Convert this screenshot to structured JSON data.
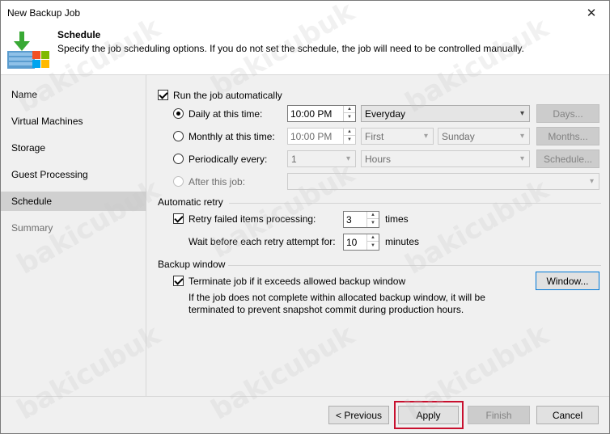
{
  "window": {
    "title": "New Backup Job",
    "close_glyph": "✕"
  },
  "header": {
    "title": "Schedule",
    "description": "Specify the job scheduling options. If you do not set the schedule, the job will need to be controlled manually.",
    "icon": "backup-job-icon"
  },
  "sidebar": {
    "items": [
      {
        "label": "Name",
        "state": "normal"
      },
      {
        "label": "Virtual Machines",
        "state": "normal"
      },
      {
        "label": "Storage",
        "state": "normal"
      },
      {
        "label": "Guest Processing",
        "state": "normal"
      },
      {
        "label": "Schedule",
        "state": "active"
      },
      {
        "label": "Summary",
        "state": "disabled"
      }
    ]
  },
  "schedule": {
    "run_auto_label": "Run the job automatically",
    "run_auto_checked": true,
    "daily": {
      "label": "Daily at this time:",
      "time": "10:00 PM",
      "days_value": "Everyday",
      "days_button": "Days...",
      "selected": true
    },
    "monthly": {
      "label": "Monthly at this time:",
      "time": "10:00 PM",
      "week": "First",
      "day": "Sunday",
      "months_button": "Months...",
      "selected": false
    },
    "periodically": {
      "label": "Periodically every:",
      "value": "1",
      "unit": "Hours",
      "schedule_button": "Schedule...",
      "selected": false
    },
    "after": {
      "label": "After this job:",
      "value": "",
      "selected": false
    }
  },
  "retry": {
    "section_title": "Automatic retry",
    "retry_label": "Retry failed items processing:",
    "retry_checked": true,
    "retry_count": "3",
    "retry_unit": "times",
    "wait_label": "Wait before each retry attempt for:",
    "wait_value": "10",
    "wait_unit": "minutes"
  },
  "backup_window": {
    "section_title": "Backup window",
    "terminate_label": "Terminate job if it exceeds allowed backup window",
    "terminate_checked": true,
    "window_button": "Window...",
    "description_line1": "If the job does not complete within allocated backup window, it will be",
    "description_line2": "terminated to prevent snapshot commit during production hours."
  },
  "footer": {
    "previous": "< Previous",
    "apply": "Apply",
    "finish": "Finish",
    "cancel": "Cancel"
  },
  "watermark": "bakicubuk",
  "colors": {
    "highlight": "#c8102e",
    "active_nav": "#d0d0d0",
    "focus_border": "#0078d7"
  }
}
